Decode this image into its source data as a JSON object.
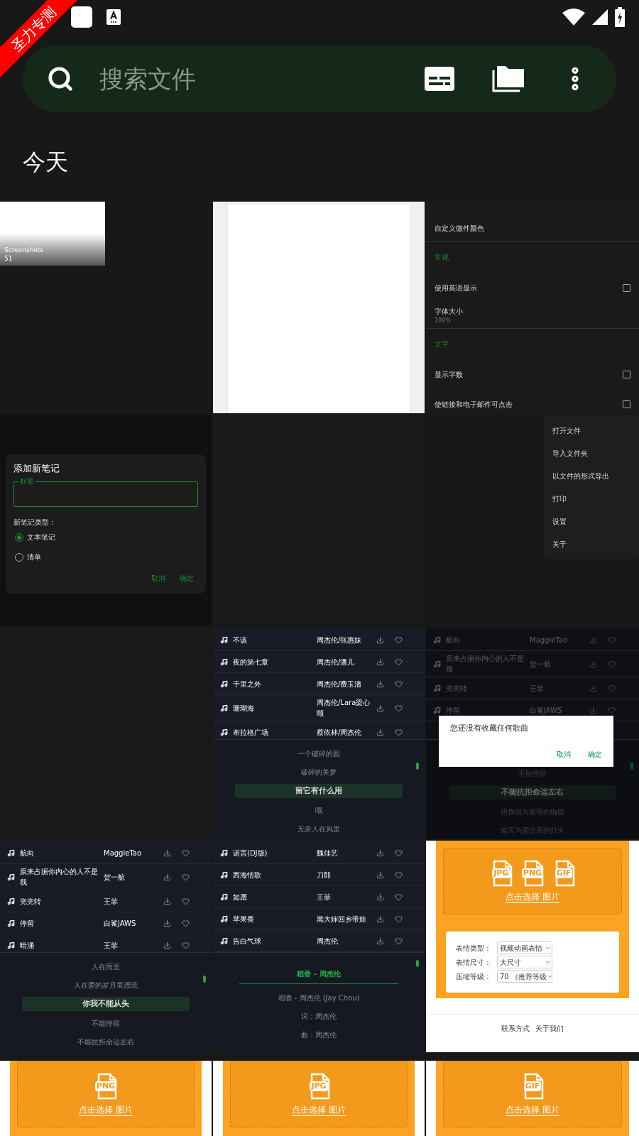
{
  "ribbon": "圣力专测",
  "search": {
    "placeholder": "搜索文件"
  },
  "section_title": "今天",
  "thumbnails": [
    {
      "kind": "folder",
      "name": "Screenshots",
      "count": "51"
    },
    {
      "kind": "document"
    },
    {
      "kind": "settings",
      "rows": [
        {
          "kind": "item",
          "label": "自定义微件颜色"
        },
        {
          "kind": "header",
          "label": "常规"
        },
        {
          "kind": "checkbox",
          "label": "使用英语显示",
          "checked": false
        },
        {
          "kind": "item",
          "label": "字体大小",
          "sub": "100%"
        },
        {
          "kind": "header",
          "label": "文字"
        },
        {
          "kind": "checkbox",
          "label": "显示字数",
          "checked": false
        },
        {
          "kind": "checkbox",
          "label": "使链接和电子邮件可点击",
          "checked": false
        }
      ]
    },
    {
      "kind": "note_dialog",
      "title": "添加新笔记",
      "field_label": "标签",
      "type_label": "新笔记类型：",
      "options": [
        {
          "label": "文本笔记",
          "selected": true
        },
        {
          "label": "清单",
          "selected": false
        }
      ],
      "buttons": [
        "取消",
        "确定"
      ]
    },
    {
      "kind": "blank"
    },
    {
      "kind": "menu",
      "items": [
        "打开文件",
        "导入文件夹",
        "以文件的形式导出",
        "打印",
        "设置",
        "关于"
      ]
    },
    {
      "kind": "blank"
    },
    {
      "kind": "music",
      "songs": [
        {
          "title": "不该",
          "artist": "周杰伦/张惠妹"
        },
        {
          "title": "夜的第七章",
          "artist": "周杰伦/潘儿"
        },
        {
          "title": "千里之外",
          "artist": "周杰伦/费玉清"
        },
        {
          "title": "珊瑚海",
          "artist": "周杰伦/Lara梁心颐"
        },
        {
          "title": "布拉格广场",
          "artist": "蔡依林/周杰伦"
        }
      ],
      "lyrics": [
        {
          "text": "一个破碎的园",
          "selected": false
        },
        {
          "text": "破碎的美梦",
          "selected": false
        },
        {
          "text": "留它有什么用",
          "selected": true
        },
        {
          "text": "哦",
          "selected": false
        },
        {
          "text": "无奈人在风里",
          "selected": false
        }
      ]
    },
    {
      "kind": "music",
      "songs": [
        {
          "title": "航向",
          "artist": "MaggieTao"
        },
        {
          "title": "原来占据你内心的人不是我",
          "artist": "贺一航"
        },
        {
          "title": "兜兜转",
          "artist": "王菲"
        },
        {
          "title": "停留",
          "artist": "白鲨JAWS"
        }
      ],
      "dialog": {
        "message": "您还没有收藏任何歌曲",
        "buttons": [
          "取消",
          "确定"
        ]
      },
      "lyrics": [
        {
          "text": "不能停留",
          "selected": false
        },
        {
          "text": "不能抗拒命运左右",
          "selected": true
        },
        {
          "text": "想挣脱为爱带的枷锁",
          "selected": false
        },
        {
          "text": "熄灭为爱点亮的灯火",
          "selected": false
        }
      ]
    },
    {
      "kind": "music",
      "songs": [
        {
          "title": "航向",
          "artist": "MaggieTao"
        },
        {
          "title": "原来占据你内心的人不是我",
          "artist": "贺一航"
        },
        {
          "title": "兜兜转",
          "artist": "王菲"
        },
        {
          "title": "停留",
          "artist": "白鲨JAWS"
        },
        {
          "title": "暗涌",
          "artist": "王菲"
        }
      ],
      "lyrics": [
        {
          "text": "人在雨里",
          "selected": false
        },
        {
          "text": "人在爱的岁月里漂流",
          "selected": false
        },
        {
          "text": "你我不能从头",
          "selected": true
        },
        {
          "text": "不能停留",
          "selected": false
        },
        {
          "text": "不能抗拒命运左右",
          "selected": false
        }
      ]
    },
    {
      "kind": "music",
      "songs": [
        {
          "title": "诺言(DJ版)",
          "artist": "魏佳艺"
        },
        {
          "title": "西海情歌",
          "artist": "刀郎"
        },
        {
          "title": "如愿",
          "artist": "王菲"
        },
        {
          "title": "苹果香",
          "artist": "黑大婶回乡带娃"
        },
        {
          "title": "告白气球",
          "artist": "周杰伦"
        }
      ],
      "lyric_title": "稻香 - 周杰伦",
      "lyrics": [
        {
          "text": "稻香 - 周杰伦 (Jay Chou)",
          "selected": false
        },
        {
          "text": "词：周杰伦",
          "selected": false
        },
        {
          "text": "曲：周杰伦",
          "selected": false
        }
      ]
    },
    {
      "kind": "image_form",
      "formats": [
        "JPG",
        "PNG",
        "GIF"
      ],
      "link": "点击选择 图片",
      "fields": [
        {
          "label": "表情类型：",
          "value": "视频动画表情"
        },
        {
          "label": "表情尺寸：",
          "value": "大尺寸"
        },
        {
          "label": "压缩等级：",
          "value": "70 （推荐等级"
        }
      ],
      "footer_links": [
        "联系方式",
        "关于我们"
      ]
    },
    {
      "kind": "upload",
      "formats": [
        "PNG"
      ],
      "link": "点击选择 图片"
    },
    {
      "kind": "upload",
      "formats": [
        "JPG"
      ],
      "link": "点击选择 图片"
    },
    {
      "kind": "upload",
      "formats": [
        "GIF"
      ],
      "link": "点击选择 图片"
    }
  ]
}
